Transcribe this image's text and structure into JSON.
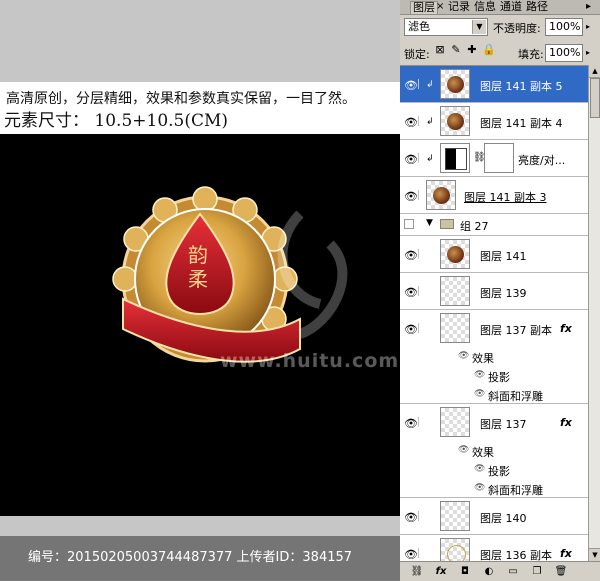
{
  "document": {
    "line1": "高清原创，分层精细，效果和参数真实保留，一目了然。",
    "line2": "元素尺寸：  10.5+10.5(CM)",
    "badge_text": "韵柔",
    "watermark_site": "www.huitu.com",
    "watermark_info": "编号：20150205003744487377 上传者ID：384157"
  },
  "panel": {
    "tabs": [
      "图层",
      "记录",
      "信息",
      "通道",
      "路径"
    ],
    "tab_close": "×",
    "menu_icon": "▸",
    "blend_mode": "滤色",
    "opacity_label": "不透明度:",
    "opacity_value": "100%",
    "lock_label": "锁定:",
    "fill_label": "填充:",
    "fill_value": "100%"
  },
  "layers": [
    {
      "name": "图层 141 副本 5",
      "selected": true
    },
    {
      "name": "图层 141 副本 4"
    },
    {
      "name": "亮度/对..."
    },
    {
      "name": "图层 141 副本 3"
    },
    {
      "name": "组 27"
    },
    {
      "name": "图层 141"
    },
    {
      "name": "图层 139"
    },
    {
      "name": "图层 137 副本",
      "fx": "fx"
    },
    {
      "name": "效果"
    },
    {
      "name": "投影"
    },
    {
      "name": "斜面和浮雕"
    },
    {
      "name": "图层 137",
      "fx": "fx"
    },
    {
      "name": "效果"
    },
    {
      "name": "投影"
    },
    {
      "name": "斜面和浮雕"
    },
    {
      "name": "图层 140"
    },
    {
      "name": "图层 136 副本",
      "fx": "fx"
    }
  ],
  "colors": {
    "selection": "#316ac5",
    "badge_red": "#c0101a",
    "badge_gold": "#d9a441"
  }
}
